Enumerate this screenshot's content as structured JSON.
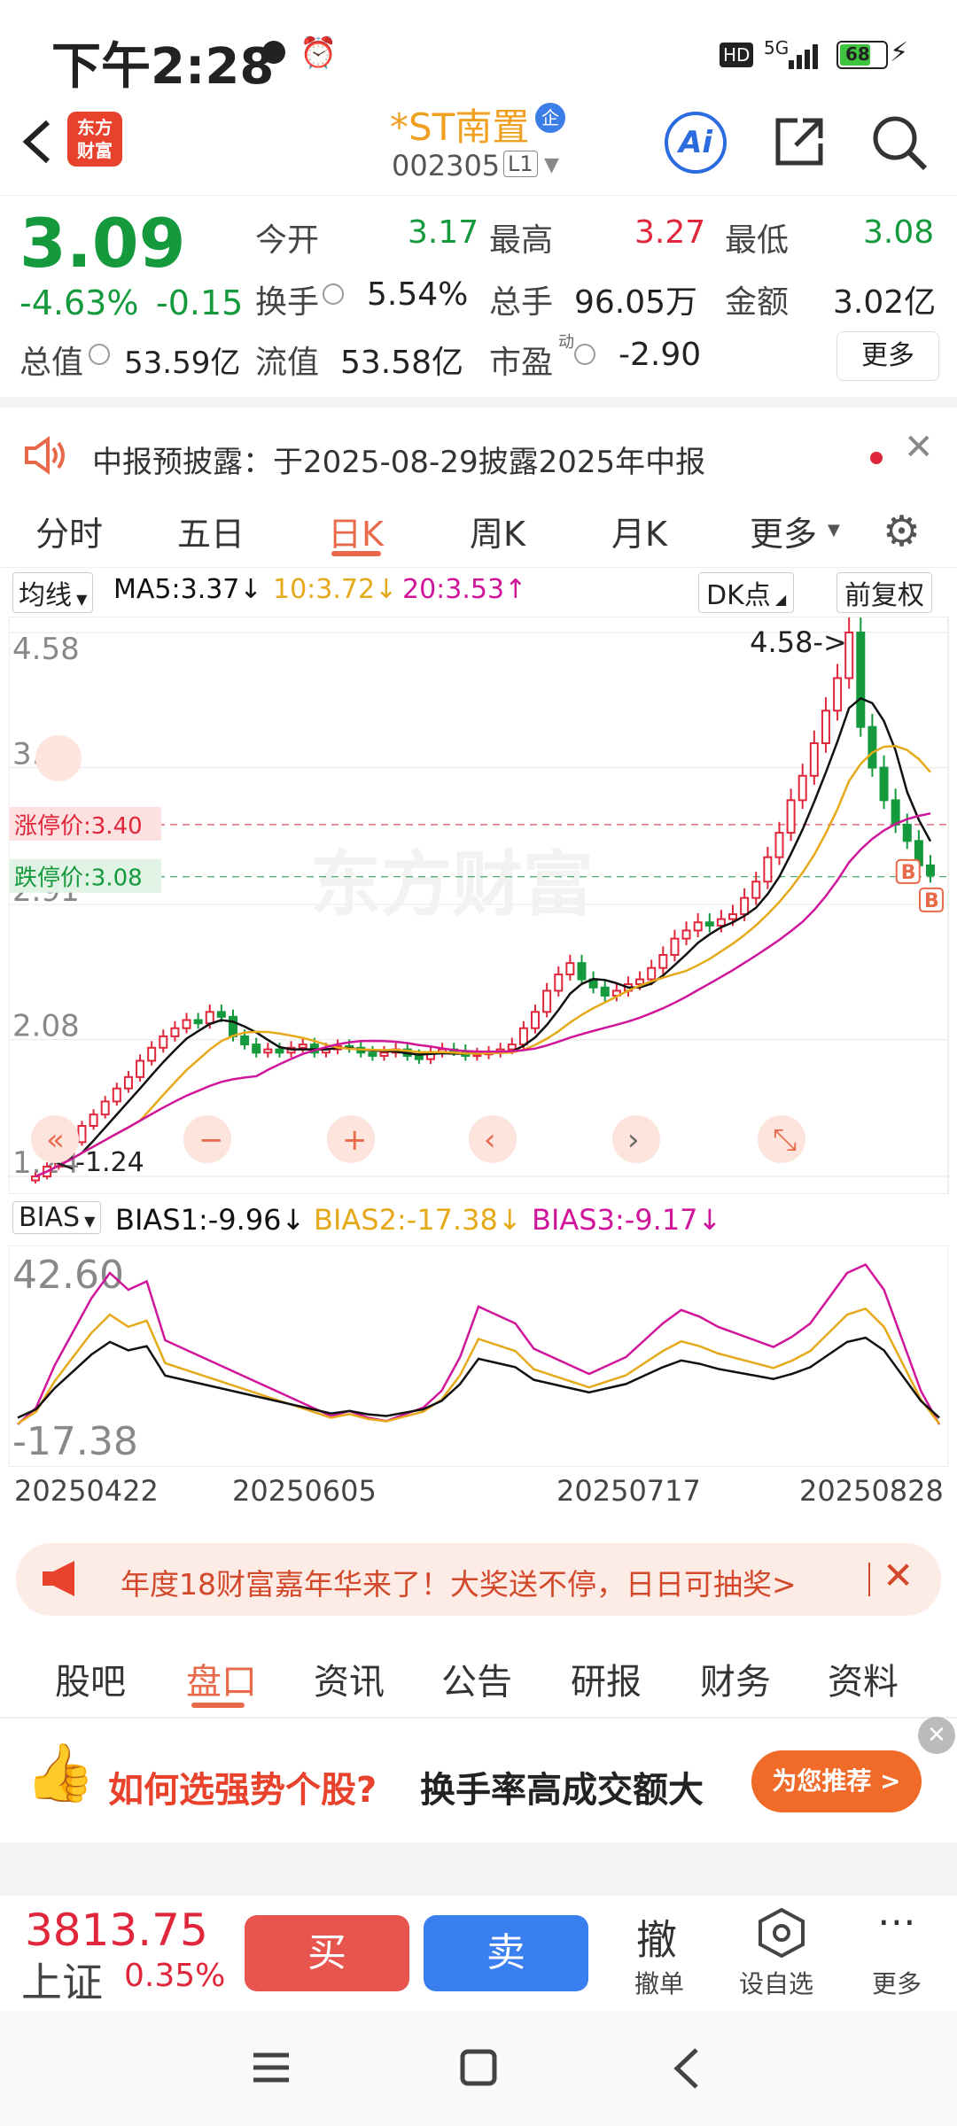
{
  "status_bar": {
    "time": "下午2:28",
    "battery": "68",
    "network": "5G",
    "hd": "HD"
  },
  "header": {
    "stock_name": "*ST南置",
    "stock_code": "002305",
    "level": "L1",
    "badge": "企",
    "ai_label": "Ai",
    "logo_line1": "东方",
    "logo_line2": "财富"
  },
  "quote": {
    "price": "3.09",
    "change_pct": "-4.63%",
    "change": "-0.15",
    "open_label": "今开",
    "open": "3.17",
    "high_label": "最高",
    "high": "3.27",
    "low_label": "最低",
    "low": "3.08",
    "turnover_label": "换手",
    "turnover": "5.54%",
    "volume_label": "总手",
    "volume": "96.05万",
    "amount_label": "金额",
    "amount": "3.02亿",
    "mktcap_label": "总值",
    "mktcap": "53.59亿",
    "float_label": "流值",
    "float": "53.58亿",
    "pe_label": "市盈",
    "pe_sup": "动",
    "pe": "-2.90",
    "more": "更多"
  },
  "notice": {
    "text": "中报预披露：于2025-08-29披露2025年中报"
  },
  "tabs": [
    "分时",
    "五日",
    "日K",
    "周K",
    "月K",
    "更多"
  ],
  "active_tab": "日K",
  "chart_toolbar": {
    "ma_select": "均线",
    "ma5": "MA5:3.37↓",
    "ma10": "10:3.72↓",
    "ma20": "20:3.53↑",
    "dk": "DK点",
    "fq": "前复权"
  },
  "chart_data": [
    {
      "type": "candlestick",
      "y_ticks": [
        "4.58",
        "3.75",
        "2.91",
        "2.08",
        "1.24"
      ],
      "ylim": [
        1.24,
        4.58
      ],
      "annotations": [
        "4.58->",
        "<-1.24",
        "涨停价:3.40",
        "跌停价:3.08",
        "B",
        "B"
      ],
      "watermark": "东方财富",
      "series": [
        {
          "name": "MA5",
          "color": "#111111"
        },
        {
          "name": "MA10",
          "color": "#e5a91a"
        },
        {
          "name": "MA20",
          "color": "#d0159a"
        }
      ],
      "limit_up": 3.4,
      "limit_down": 3.08,
      "approx_closes": [
        1.24,
        1.3,
        1.38,
        1.45,
        1.55,
        1.62,
        1.7,
        1.78,
        1.85,
        1.95,
        2.03,
        2.1,
        2.15,
        2.2,
        2.18,
        2.25,
        2.22,
        2.1,
        2.05,
        2.0,
        2.02,
        2.0,
        2.03,
        2.05,
        2.0,
        2.02,
        2.04,
        2.03,
        2.0,
        1.98,
        2.0,
        2.02,
        1.98,
        1.96,
        2.0,
        2.02,
        2.01,
        1.98,
        1.99,
        2.0,
        2.02,
        2.05,
        2.15,
        2.25,
        2.38,
        2.48,
        2.55,
        2.45,
        2.4,
        2.35,
        2.38,
        2.42,
        2.45,
        2.52,
        2.6,
        2.7,
        2.75,
        2.8,
        2.78,
        2.82,
        2.85,
        2.95,
        3.05,
        3.2,
        3.35,
        3.55,
        3.7,
        3.9,
        4.1,
        4.3,
        4.58,
        4.0,
        3.75,
        3.55,
        3.4,
        3.3,
        3.15,
        3.09
      ]
    },
    {
      "type": "line",
      "indicator_select": "BIAS",
      "bias1": "BIAS1:-9.96↓",
      "bias2": "BIAS2:-17.38↓",
      "bias3": "BIAS3:-9.17↓",
      "y_ticks": [
        "42.60",
        "-17.38"
      ],
      "ylim": [
        -17.38,
        42.6
      ],
      "x_ticks": [
        "20250422",
        "20250605",
        "20250717",
        "20250828"
      ]
    }
  ],
  "banner": {
    "text": "年度18财富嘉年华来了！大奖送不停，日日可抽奖>"
  },
  "sub_tabs": [
    "股吧",
    "盘口",
    "资讯",
    "公告",
    "研报",
    "财务",
    "资料"
  ],
  "active_sub_tab": "盘口",
  "ad": {
    "text1": "如何选强势个股?",
    "text2": "换手率高成交额大",
    "button": "为您推荐 >"
  },
  "bottom_bar": {
    "index_value": "3813.75",
    "index_name": "上证",
    "index_change": "0.35%",
    "buy": "买",
    "sell": "卖",
    "cancel_icon": "撤",
    "cancel": "撤单",
    "watch": "设自选",
    "more": "更多"
  },
  "colors": {
    "up": "#e0263a",
    "down": "#149a3c",
    "accent": "#e86a4b",
    "blue": "#2a7de1"
  }
}
